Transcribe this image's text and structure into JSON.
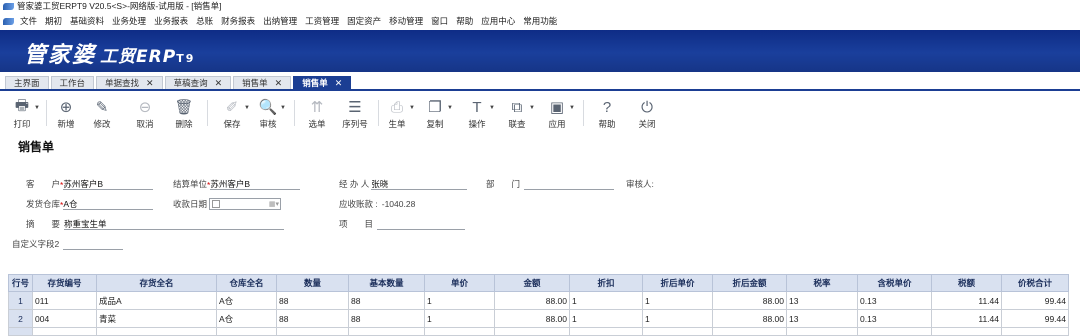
{
  "window": {
    "title": "管家婆工贸ERPT9 V20.5<S>-网络版-试用版 - [销售单]"
  },
  "menu": [
    "文件",
    "期初",
    "基础资料",
    "业务处理",
    "业务报表",
    "总账",
    "财务报表",
    "出纳管理",
    "工资管理",
    "固定资产",
    "移动管理",
    "窗口",
    "帮助",
    "应用中心",
    "常用功能"
  ],
  "banner": {
    "logo_main": "管家婆",
    "logo_sub": "工贸ERP",
    "logo_ver": "T9"
  },
  "tabs": [
    {
      "label": "主界面",
      "closable": false,
      "active": false
    },
    {
      "label": "工作台",
      "closable": false,
      "active": false
    },
    {
      "label": "单据查找",
      "closable": true,
      "active": false
    },
    {
      "label": "草稿查询",
      "closable": true,
      "active": false
    },
    {
      "label": "销售单",
      "closable": true,
      "active": false
    },
    {
      "label": "销售单",
      "closable": true,
      "active": true
    }
  ],
  "toolbar": [
    {
      "label": "打印",
      "icon": "print-icon",
      "glyph": "🖶",
      "dropdown": true,
      "disabled": false
    },
    {
      "label": "新增",
      "icon": "add-icon",
      "glyph": "⊕",
      "dropdown": false,
      "disabled": false
    },
    {
      "label": "修改",
      "icon": "edit-icon",
      "glyph": "✎",
      "dropdown": false,
      "disabled": false
    },
    {
      "label": "取消",
      "icon": "cancel-icon",
      "glyph": "⊖",
      "dropdown": false,
      "disabled": true
    },
    {
      "label": "删除",
      "icon": "delete-icon",
      "glyph": "🗑",
      "dropdown": false,
      "disabled": false
    },
    {
      "label": "保存",
      "icon": "save-icon",
      "glyph": "✐",
      "dropdown": true,
      "disabled": true
    },
    {
      "label": "审核",
      "icon": "audit-icon",
      "glyph": "🔍",
      "dropdown": true,
      "disabled": false
    },
    {
      "label": "选单",
      "icon": "select-order-icon",
      "glyph": "⇈",
      "dropdown": false,
      "disabled": true
    },
    {
      "label": "序列号",
      "icon": "serial-number-icon",
      "glyph": "☰",
      "dropdown": false,
      "disabled": false
    },
    {
      "label": "生单",
      "icon": "generate-order-icon",
      "glyph": "⎙",
      "dropdown": true,
      "disabled": true
    },
    {
      "label": "复制",
      "icon": "copy-icon",
      "glyph": "❐",
      "dropdown": true,
      "disabled": false
    },
    {
      "label": "操作",
      "icon": "operation-icon",
      "glyph": "T",
      "dropdown": true,
      "disabled": false
    },
    {
      "label": "联查",
      "icon": "link-query-icon",
      "glyph": "⧉",
      "dropdown": true,
      "disabled": false
    },
    {
      "label": "应用",
      "icon": "apply-icon",
      "glyph": "▣",
      "dropdown": true,
      "disabled": false
    },
    {
      "label": "帮助",
      "icon": "help-icon",
      "glyph": "?",
      "dropdown": false,
      "disabled": false
    },
    {
      "label": "关闭",
      "icon": "power-icon",
      "glyph": "⏻",
      "dropdown": false,
      "disabled": false
    }
  ],
  "form": {
    "title": "销售单",
    "customer_label": "客　　户",
    "customer_value": "苏州客户B",
    "settle_label": "结算单位",
    "settle_value": "苏州客户B",
    "handler_label": "经 办 人",
    "handler_value": "张晓",
    "dept_label": "部　　门",
    "dept_value": "",
    "auditor_label": "审核人:",
    "warehouse_label": "发货仓库",
    "warehouse_value": "A仓",
    "collect_date_label": "收款日期",
    "receivable_label": "应收账款 :",
    "receivable_value": "-1040.28",
    "summary_label": "摘　　要",
    "summary_value": "称重宝生单",
    "project_label": "项　　目",
    "project_value": "",
    "custom2_label": "自定义字段2",
    "custom2_value": ""
  },
  "grid": {
    "columns": [
      "行号",
      "存货编号",
      "存货全名",
      "仓库全名",
      "数量",
      "基本数量",
      "单价",
      "金额",
      "折扣",
      "折后单价",
      "折后金额",
      "税率",
      "含税单价",
      "税额",
      "价税合计"
    ],
    "rows": [
      [
        "1",
        "011",
        "成品A",
        "A仓",
        "88",
        "88",
        "1",
        "88.00",
        "1",
        "1",
        "88.00",
        "13",
        "0.13",
        "11.44",
        "99.44"
      ],
      [
        "2",
        "004",
        "青菜",
        "A仓",
        "88",
        "88",
        "1",
        "88.00",
        "1",
        "1",
        "88.00",
        "13",
        "0.13",
        "11.44",
        "99.44"
      ]
    ]
  }
}
